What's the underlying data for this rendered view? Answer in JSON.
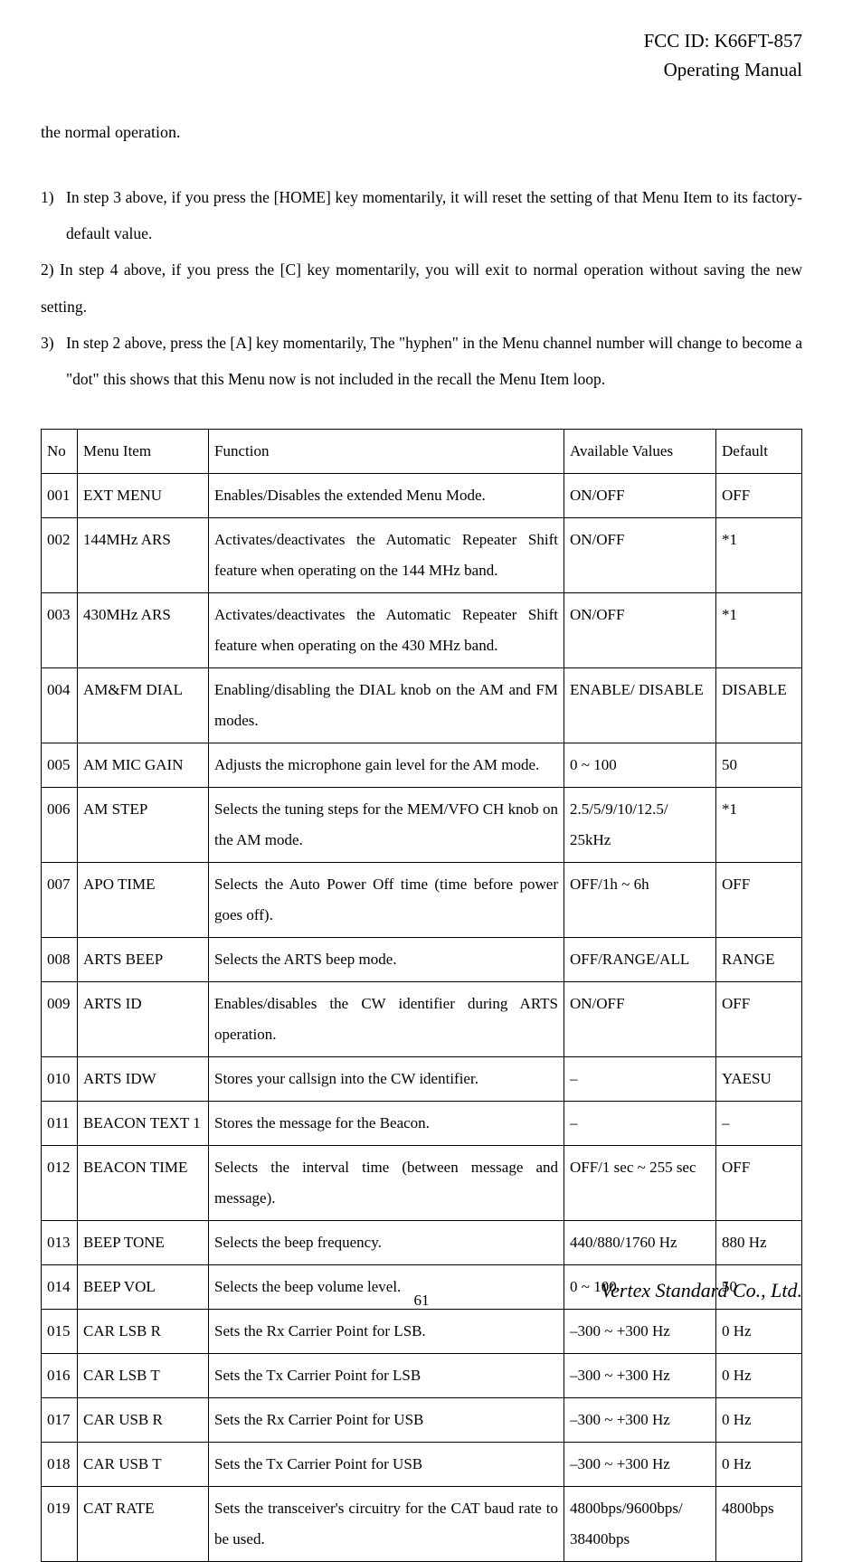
{
  "header": {
    "fcc": "FCC ID: K66FT-857",
    "subtitle": "Operating Manual"
  },
  "intro": "the normal operation.",
  "notes": [
    {
      "num": "1)",
      "text": "In step 3 above, if you press the [HOME] key momentarily, it will reset the setting of that Menu Item to its factory-default value."
    },
    {
      "num": "",
      "text": "2) In step 4 above, if you press the [C] key momentarily, you will exit to normal operation without saving the new setting."
    },
    {
      "num": "3)",
      "text": "In step 2 above, press the [A] key momentarily, The \"hyphen\" in the Menu channel number will change to become a \"dot\" this shows that this Menu now is not included in the recall the Menu Item loop."
    }
  ],
  "table": {
    "headers": {
      "no": "No",
      "menu": "Menu Item",
      "func": "Function",
      "av": "Available Values",
      "def": "Default"
    },
    "rows": [
      {
        "no": "001",
        "menu": "EXT MENU",
        "func": "Enables/Disables the extended Menu Mode.",
        "av": "ON/OFF",
        "def": "OFF"
      },
      {
        "no": "002",
        "menu": "144MHz ARS",
        "func": "Activates/deactivates the Automatic Repeater Shift feature when operating on the 144 MHz band.",
        "av": "ON/OFF",
        "def": "*1"
      },
      {
        "no": "003",
        "menu": "430MHz ARS",
        "func": "Activates/deactivates the Automatic Repeater Shift feature when operating on the 430 MHz band.",
        "av": "ON/OFF",
        "def": "*1"
      },
      {
        "no": "004",
        "menu": "AM&FM DIAL",
        "func": "Enabling/disabling the DIAL knob on the AM and FM modes.",
        "av": "ENABLE/ DISABLE",
        "def": "DISABLE"
      },
      {
        "no": "005",
        "menu": "AM MIC GAIN",
        "func": "Adjusts the microphone gain level for the AM mode.",
        "av": "0 ~ 100",
        "def": "50"
      },
      {
        "no": "006",
        "menu": "AM STEP",
        "func": "Selects the tuning steps for the MEM/VFO CH knob on the AM mode.",
        "av": "2.5/5/9/10/12.5/ 25kHz",
        "def": "*1"
      },
      {
        "no": "007",
        "menu": "APO TIME",
        "func": "Selects the Auto Power Off time (time before power goes off).",
        "av": "OFF/1h ~ 6h",
        "def": "OFF"
      },
      {
        "no": "008",
        "menu": "ARTS BEEP",
        "func": "Selects the ARTS beep mode.",
        "av": "OFF/RANGE/ALL",
        "def": "RANGE"
      },
      {
        "no": "009",
        "menu": "ARTS ID",
        "func": "Enables/disables the CW identifier during ARTS operation.",
        "av": "ON/OFF",
        "def": "OFF"
      },
      {
        "no": "010",
        "menu": "ARTS IDW",
        "func": "Stores your callsign into the CW identifier.",
        "av": "–",
        "def": "YAESU"
      },
      {
        "no": "011",
        "menu": "BEACON TEXT 1",
        "func": "Stores the message for the Beacon.",
        "av": "–",
        "def": "–"
      },
      {
        "no": "012",
        "menu": "BEACON TIME",
        "func": "Selects the interval time (between message and message).",
        "av": "OFF/1 sec ~ 255 sec",
        "def": "OFF"
      },
      {
        "no": "013",
        "menu": "BEEP TONE",
        "func": "Selects the beep frequency.",
        "av": "440/880/1760 Hz",
        "def": "880 Hz"
      },
      {
        "no": "014",
        "menu": "BEEP VOL",
        "func": "Selects the beep volume level.",
        "av": "0 ~ 100",
        "def": "50"
      },
      {
        "no": "015",
        "menu": "CAR LSB R",
        "func": "Sets the Rx Carrier Point for LSB.",
        "av": "–300 ~ +300 Hz",
        "def": "0 Hz"
      },
      {
        "no": "016",
        "menu": "CAR LSB T",
        "func": "Sets the Tx Carrier Point for LSB",
        "av": "–300 ~ +300 Hz",
        "def": "0 Hz"
      },
      {
        "no": "017",
        "menu": "CAR USB R",
        "func": "Sets the Rx Carrier Point for USB",
        "av": "–300 ~ +300 Hz",
        "def": "0 Hz"
      },
      {
        "no": "018",
        "menu": "CAR USB T",
        "func": "Sets the Tx Carrier Point for USB",
        "av": "–300 ~ +300 Hz",
        "def": "0 Hz"
      },
      {
        "no": "019",
        "menu": "CAT RATE",
        "func": "Sets the transceiver's circuitry for the CAT baud rate to be used.",
        "av": "4800bps/9600bps/ 38400bps",
        "def": "4800bps"
      }
    ]
  },
  "footer": "Vertex Standard Co., Ltd.",
  "pagenum": "61"
}
